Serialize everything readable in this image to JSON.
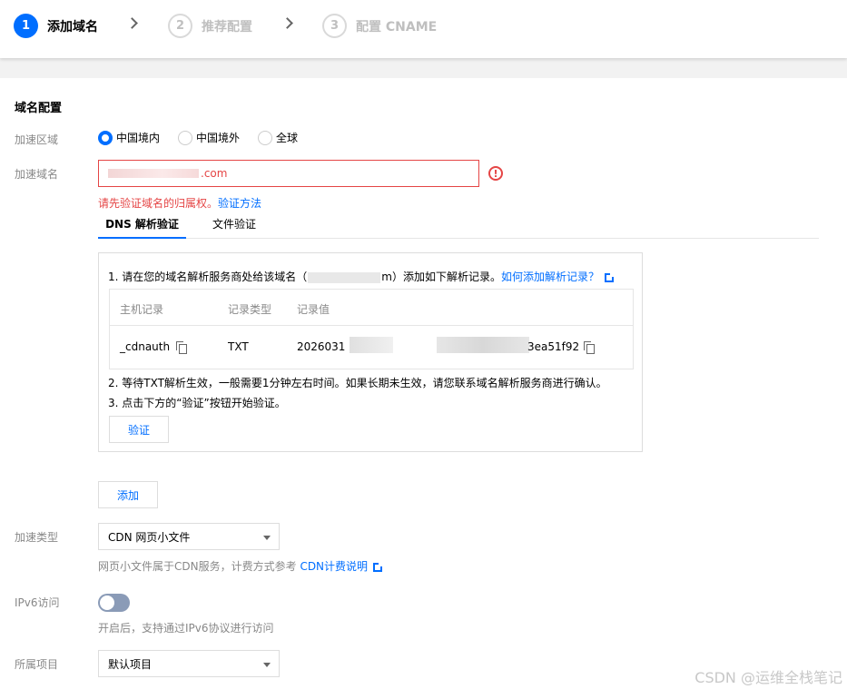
{
  "steps": [
    {
      "num": "1",
      "label": "添加域名"
    },
    {
      "num": "2",
      "label": "推荐配置"
    },
    {
      "num": "3",
      "label": "配置 CNAME"
    }
  ],
  "section_title": "域名配置",
  "region": {
    "label": "加速区域",
    "options": [
      "中国境内",
      "中国境外",
      "全球"
    ],
    "selected": "中国境内"
  },
  "domain": {
    "label": "加速域名",
    "value_suffix": ".com",
    "error_icon": "!",
    "error_text": "请先验证域名的归属权。",
    "error_link": "验证方法"
  },
  "verify_tabs": [
    "DNS 解析验证",
    "文件验证"
  ],
  "dns_box": {
    "step1_prefix": "1. 请在您的域名解析服务商处给该域名（",
    "step1_visible_tail": "m）添加如下解析记录。",
    "step1_link": "如何添加解析记录？",
    "table": {
      "headers": [
        "主机记录",
        "记录类型",
        "记录值"
      ],
      "row": {
        "host": "_cdnauth",
        "type": "TXT",
        "value_prefix": "2026031",
        "value_suffix": "3ea51f92"
      }
    },
    "step2": "2. 等待TXT解析生效，一般需要1分钟左右时间。如果长期未生效，请您联系域名解析服务商进行确认。",
    "step3": "3. 点击下方的“验证”按钮开始验证。",
    "verify_button": "验证"
  },
  "add_button": "添加",
  "accel_type": {
    "label": "加速类型",
    "selected": "CDN 网页小文件",
    "hint": "网页小文件属于CDN服务，计费方式参考",
    "hint_link": "CDN计费说明"
  },
  "ipv6": {
    "label": "IPv6访问",
    "enabled": false,
    "hint": "开启后，支持通过IPv6协议进行访问"
  },
  "project": {
    "label": "所属项目",
    "selected": "默认项目"
  },
  "watermark": "CSDN @运维全栈笔记",
  "colors": {
    "primary": "#006eff",
    "error": "#e54545",
    "muted": "#888888"
  }
}
